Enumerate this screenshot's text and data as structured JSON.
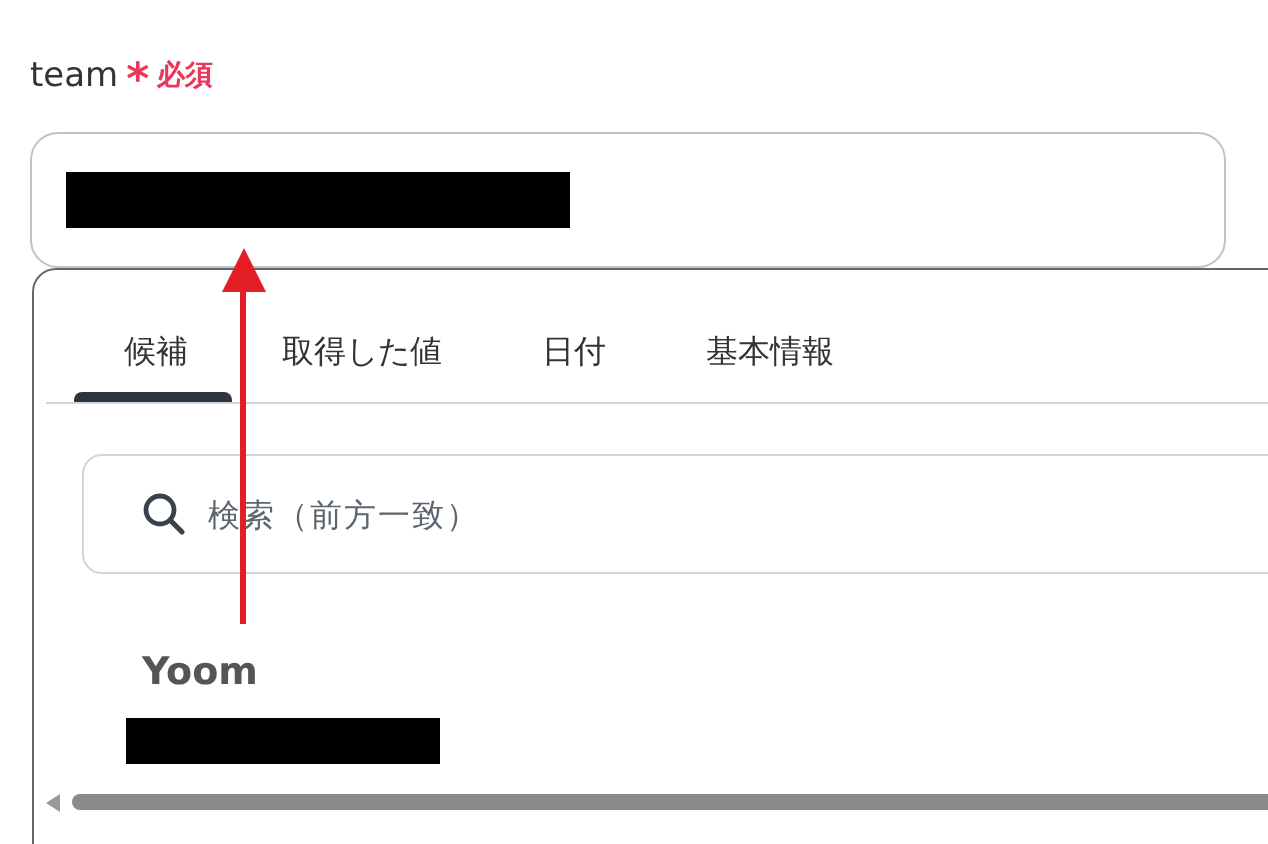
{
  "field": {
    "label": "team",
    "required_mark": "*",
    "required_text": "必須"
  },
  "panel": {
    "tabs": [
      {
        "label": "候補",
        "selected": true
      },
      {
        "label": "取得した値",
        "selected": false
      },
      {
        "label": "日付",
        "selected": false
      },
      {
        "label": "基本情報",
        "selected": false
      }
    ],
    "search": {
      "placeholder": "検索（前方一致）"
    },
    "group": {
      "title": "Yoom"
    }
  }
}
